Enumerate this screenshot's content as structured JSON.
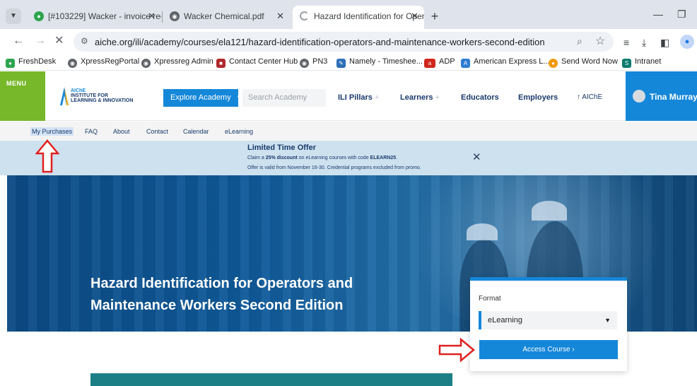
{
  "browser": {
    "tabs": [
      {
        "title": "[#103229] Wacker - invoice req",
        "icon": "freshdesk-icon"
      },
      {
        "title": "Wacker Chemical.pdf",
        "icon": "globe-icon"
      },
      {
        "title": "Hazard Identification for Oper",
        "icon": "loading-icon"
      }
    ],
    "url": "aiche.org/ili/academy/courses/ela121/hazard-identification-operators-and-maintenance-workers-second-edition",
    "bookmarks": [
      {
        "label": "FreshDesk",
        "color": "#2da44e"
      },
      {
        "label": "XpressRegPortal",
        "color": "#5f6368"
      },
      {
        "label": "Xpressreg Admin",
        "color": "#5f6368"
      },
      {
        "label": "Contact Center Hub",
        "color": "#b0282d"
      },
      {
        "label": "PN3",
        "color": "#5f6368"
      },
      {
        "label": "Namely - Timeshee...",
        "color": "#2d6fb8"
      },
      {
        "label": "ADP",
        "color": "#d0271d"
      },
      {
        "label": "American Express L...",
        "color": "#2b7bd1"
      },
      {
        "label": "Send Word Now",
        "color": "#f29800"
      },
      {
        "label": "Intranet",
        "color": "#0a7b6e"
      }
    ]
  },
  "site": {
    "menu_label": "MENU",
    "logo_line1": "AIChE",
    "logo_line2": "INSTITUTE FOR",
    "logo_line3": "LEARNING & INNOVATION",
    "explore_label": "Explore Academy",
    "search_placeholder": "Search Academy",
    "nav": [
      {
        "label": "ILI Pillars",
        "plus": "+"
      },
      {
        "label": "Learners",
        "plus": "+"
      },
      {
        "label": "Educators",
        "plus": ""
      },
      {
        "label": "Employers",
        "plus": ""
      }
    ],
    "aiche_link": "↑ AIChE",
    "user_name": "Tina Murray",
    "subnav": [
      "My Purchases",
      "FAQ",
      "About",
      "Contact",
      "Calendar",
      "eLearning"
    ]
  },
  "promo": {
    "title": "Limited Time Offer",
    "line1_prefix": "Claim a ",
    "line1_bold": "25% discount",
    "line1_mid": " on eLearning courses with code ",
    "line1_code": "ELEARN25",
    "line1_suffix": ".",
    "line2": "Offer is valid from November 16-30. Credential programs excluded from promo."
  },
  "hero": {
    "title": "Hazard Identification for Operators and Maintenance Workers Second Edition"
  },
  "format_card": {
    "label": "Format",
    "selected": "eLearning",
    "cta": "Access Course  ›"
  },
  "colors": {
    "accent_blue": "#1587d9",
    "menu_green": "#76b82a",
    "annotation_red": "#e02020"
  }
}
